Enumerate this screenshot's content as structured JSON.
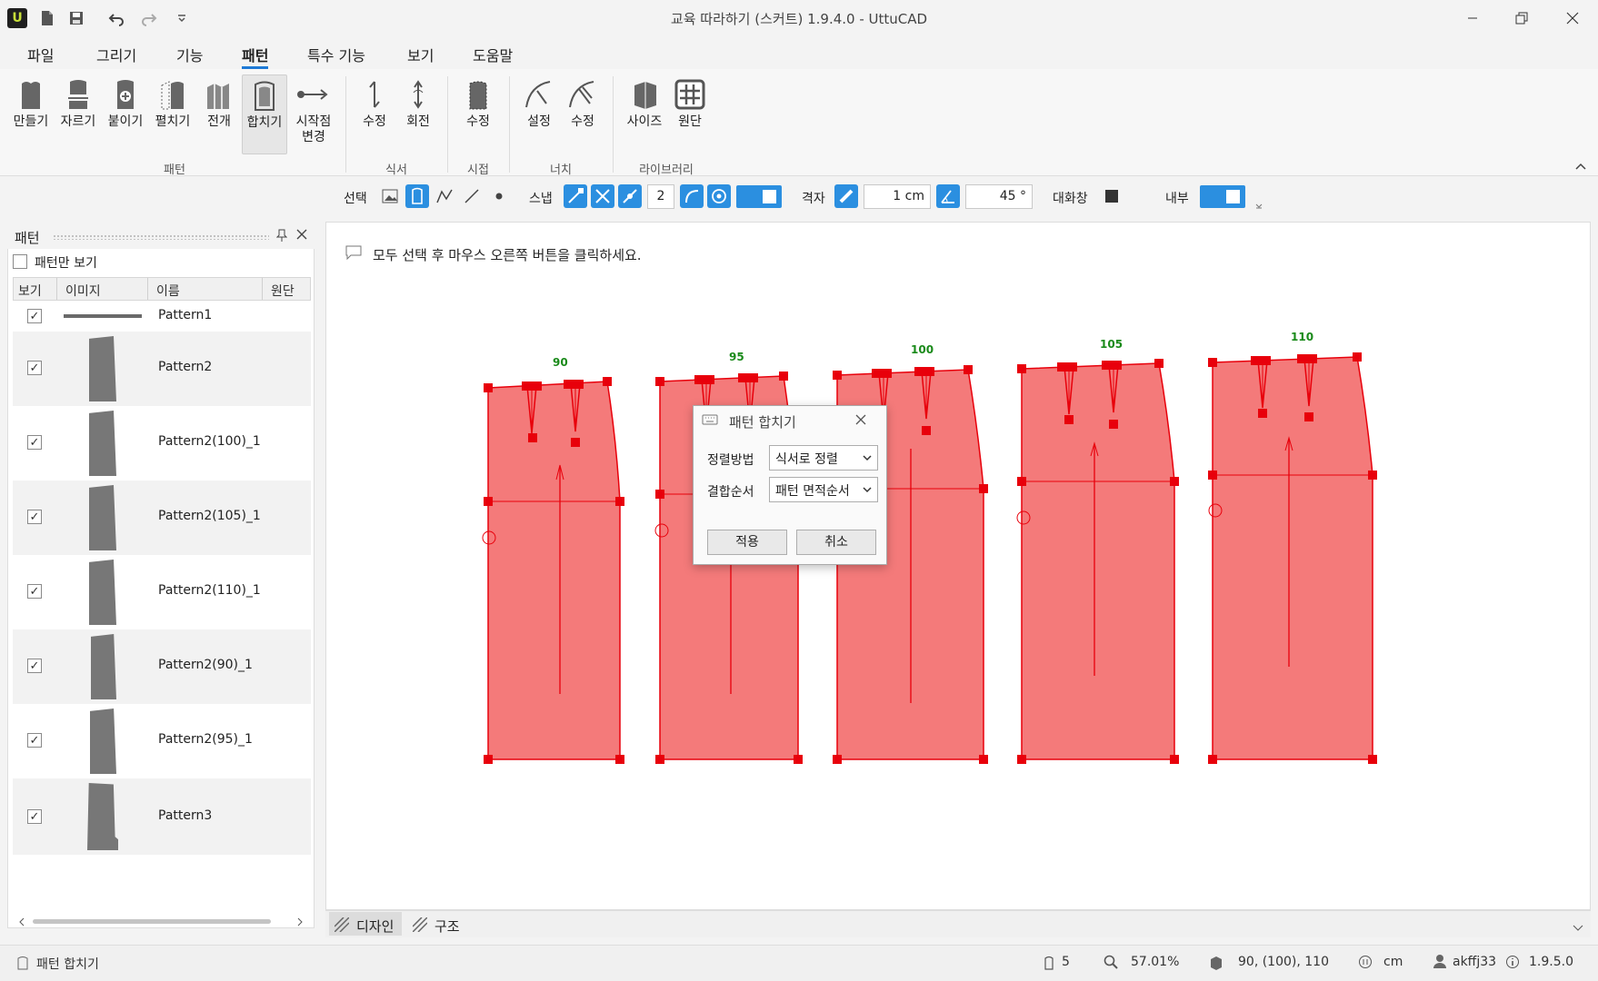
{
  "app": {
    "logo": "U",
    "title": "교육 따라하기 (스커트) 1.9.4.0 - UttuCAD"
  },
  "menu": [
    "파일",
    "그리기",
    "기능",
    "패턴",
    "특수 기능",
    "보기",
    "도움말"
  ],
  "ribbon": {
    "pattern_group": [
      "만들기",
      "자르기",
      "붙이기",
      "펼치기",
      "전개",
      "합치기",
      "시작점 변경"
    ],
    "pattern_group_label": "패턴",
    "seam_group": [
      "수정",
      "회전"
    ],
    "seam_group_label": "식서",
    "notch_group": [
      "수정"
    ],
    "notch_group_label": "시접",
    "curve_group": [
      "설정",
      "수정"
    ],
    "curve_group_label": "너치",
    "library_group": [
      "사이즈",
      "원단"
    ],
    "library_group_label": "라이브러리"
  },
  "toolbar": {
    "select_label": "선택",
    "snap_label": "스냅",
    "snap_value": "2",
    "grid_label": "격자",
    "grid_value": "1 cm",
    "angle_value": "45 °",
    "dialog_label": "대화창",
    "inner_label": "내부"
  },
  "panel": {
    "title": "패턴",
    "only_patterns_label": "패턴만 보기",
    "columns": [
      "보기",
      "이미지",
      "이름",
      "원단"
    ],
    "rows": [
      {
        "name": "Pattern1",
        "checked": true
      },
      {
        "name": "Pattern2",
        "checked": true
      },
      {
        "name": "Pattern2(100)_1",
        "checked": true
      },
      {
        "name": "Pattern2(105)_1",
        "checked": true
      },
      {
        "name": "Pattern2(110)_1",
        "checked": true
      },
      {
        "name": "Pattern2(90)_1",
        "checked": true
      },
      {
        "name": "Pattern2(95)_1",
        "checked": true
      },
      {
        "name": "Pattern3",
        "checked": true
      }
    ]
  },
  "canvas": {
    "hint": "모두 선택 후 마우스 오른쪽 버튼을 클릭하세요.",
    "size_labels": [
      "90",
      "95",
      "100",
      "105",
      "110"
    ],
    "pattern_color": "#f47a7a",
    "outline_color": "#e8000b",
    "label_color": "#1a8a1a",
    "tabs": [
      "디자인",
      "구조"
    ]
  },
  "dialog": {
    "title": "패턴 합치기",
    "align_label": "정렬방법",
    "align_value": "식서로 정렬",
    "order_label": "결합순서",
    "order_value": "패턴 면적순서",
    "apply": "적용",
    "cancel": "취소"
  },
  "status": {
    "left": "패턴 합치기",
    "count": "5",
    "zoom": "57.01%",
    "sizes": "90, (100), 110",
    "unit": "cm",
    "user": "akffj33",
    "version": "1.9.5.0"
  },
  "colors": {
    "accent": "#2b8fe0"
  }
}
